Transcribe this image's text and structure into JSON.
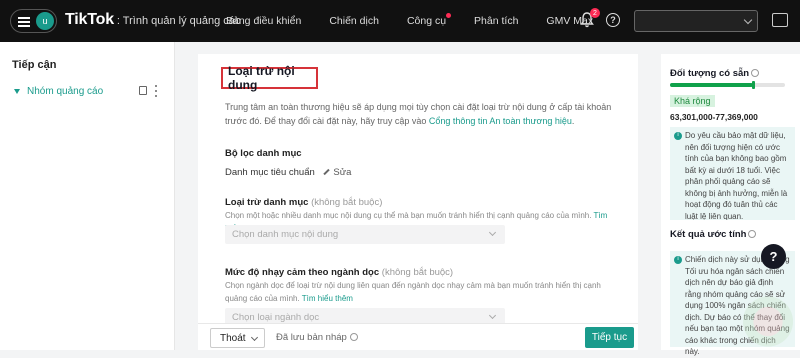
{
  "topbar": {
    "avatar_letter": "u",
    "brand": "TikTok",
    "brand_suffix": ": Trình quản lý quảng cáo",
    "nav": [
      "Bảng điều khiển",
      "Chiến dịch",
      "Công cụ",
      "Phân tích",
      "GMV Max"
    ],
    "notification_count": "2",
    "help_symbol": "?"
  },
  "sidebar": {
    "title": "Tiếp cận",
    "items": [
      {
        "label": "Nhóm quảng cáo"
      }
    ]
  },
  "main": {
    "section_title": "Loại trừ nội dung",
    "intro_text": "Trung tâm an toàn thương hiệu sẽ áp dụng mọi tùy chọn cài đặt loại trừ nội dung ở cấp tài khoản trước đó. Để thay đổi cài đặt này, hãy truy cập vào ",
    "intro_link": "Cổng thông tin An toàn thương hiệu",
    "intro_end": ".",
    "filter_label": "Bộ lọc danh mục",
    "filter_value": "Danh mục tiêu chuẩn",
    "edit_label": "Sửa",
    "category_label": "Loại trừ danh mục",
    "optional": "(không bắt buộc)",
    "category_help": "Chọn một hoặc nhiều danh mục nội dung cụ thể mà bạn muốn tránh hiển thị cạnh quảng cáo của mình. ",
    "learn_more": "Tìm hiểu thêm",
    "category_placeholder": "Chọn danh mục nội dung",
    "sensitivity_label": "Mức độ nhạy cảm theo ngành dọc",
    "sensitivity_help": "Chọn ngành dọc để loại trừ nội dung liên quan đến ngành dọc nhạy cảm mà bạn muốn tránh hiển thị cạnh quảng cáo của mình. ",
    "sensitivity_placeholder": "Chọn loại ngành dọc"
  },
  "footer": {
    "exit_label": "Thoát",
    "draft_label": "Đã lưu bản nháp",
    "continue_label": "Tiếp tục"
  },
  "audience": {
    "title": "Đối tượng có sẵn",
    "size_tag": "Khá rộng",
    "range": "63,301,000-77,369,000",
    "note": "Do yêu cầu bảo mật dữ liệu, nên đối tượng hiện có ước tính của bạn không bao gồm bất kỳ ai dưới 18 tuổi. Việc phân phối quảng cáo sẽ không bị ảnh hưởng, miễn là hoạt động đó tuân thủ các luật lệ liên quan.",
    "bar_fill_fraction": 0.72
  },
  "estimate": {
    "title": "Kết quả ước tính",
    "note": "Chiến dịch này sử dụng năng Tối ưu hóa ngân sách chiến dịch nên dự báo giả định rằng nhóm quảng cáo sẽ sử dụng 100% ngân sách chiến dịch. Dự báo có thể thay đổi nếu bạn tạo một nhóm quảng cáo khác trong chiến dịch này."
  },
  "float_help": "?",
  "colors": {
    "accent": "#1a9b8c",
    "brand_red": "#fe2c55",
    "audience_green": "#0fa14a"
  }
}
